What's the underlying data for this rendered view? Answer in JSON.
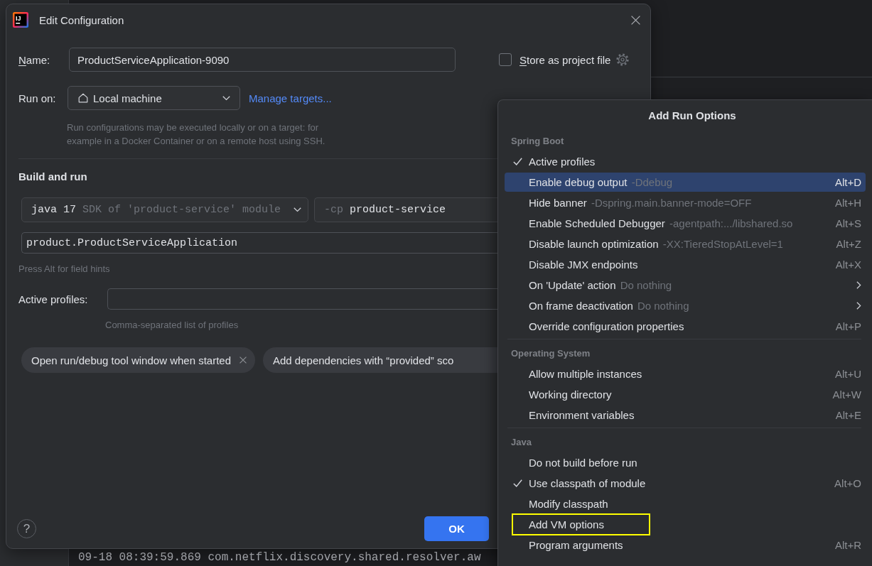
{
  "window": {
    "title": "Edit Configuration",
    "logo_text": "IJ"
  },
  "name": {
    "label": "Name:",
    "mnemonic": true,
    "value": "ProductServiceApplication-9090"
  },
  "store_as_project_file": {
    "label": "Store as project file",
    "mnemonic": true,
    "checked": false
  },
  "run_on": {
    "label": "Run on:",
    "value": "Local machine",
    "link": "Manage targets...",
    "hint_lines": [
      "Run configurations may be executed locally or on a target: for",
      "example in a Docker Container or on a remote host using SSH."
    ]
  },
  "build_and_run": {
    "heading": "Build and run",
    "jre": {
      "value": "java 17",
      "hint": "SDK of 'product-service' module"
    },
    "classpath": {
      "prefix": "-cp",
      "value": "product-service"
    },
    "main_class": {
      "value": "product.ProductServiceApplication"
    },
    "field_hint": "Press Alt for field hints"
  },
  "active_profiles": {
    "label": "Active profiles:",
    "hint": "Comma-separated list of profiles"
  },
  "option_chips": [
    {
      "label": "Open run/debug tool window when started",
      "removable": true
    },
    {
      "label": "Add dependencies with “provided” sco",
      "removable": false
    }
  ],
  "footer": {
    "help": "?",
    "ok": "OK"
  },
  "run_options": {
    "title": "Add Run Options",
    "sections": [
      {
        "title": "Spring Boot",
        "items": [
          {
            "kind": "option",
            "label": "Active profiles",
            "checked": true,
            "selected": false,
            "outlined": false
          },
          {
            "kind": "option",
            "label": "Enable debug output",
            "hint": "-Ddebug",
            "shortcut": "Alt+D",
            "checked": false,
            "selected": true,
            "outlined": false
          },
          {
            "kind": "option",
            "label": "Hide banner",
            "hint": "-Dspring.main.banner-mode=OFF",
            "shortcut": "Alt+H",
            "checked": false,
            "selected": false,
            "outlined": false
          },
          {
            "kind": "option",
            "label": "Enable Scheduled Debugger",
            "hint": "-agentpath:.../libshared.so",
            "shortcut": "Alt+S",
            "checked": false,
            "selected": false,
            "outlined": false
          },
          {
            "kind": "option",
            "label": "Disable launch optimization",
            "hint": "-XX:TieredStopAtLevel=1",
            "shortcut": "Alt+Z",
            "checked": false,
            "selected": false,
            "outlined": false
          },
          {
            "kind": "option",
            "label": "Disable JMX endpoints",
            "shortcut": "Alt+X",
            "checked": false,
            "selected": false,
            "outlined": false
          },
          {
            "kind": "submenu",
            "label": "On 'Update' action",
            "hint": "Do nothing",
            "checked": false,
            "selected": false,
            "outlined": false
          },
          {
            "kind": "submenu",
            "label": "On frame deactivation",
            "hint": "Do nothing",
            "checked": false,
            "selected": false,
            "outlined": false
          },
          {
            "kind": "option",
            "label": "Override configuration properties",
            "shortcut": "Alt+P",
            "checked": false,
            "selected": false,
            "outlined": false
          }
        ]
      },
      {
        "title": "Operating System",
        "items": [
          {
            "kind": "option",
            "label": "Allow multiple instances",
            "shortcut": "Alt+U",
            "checked": false,
            "selected": false,
            "outlined": false
          },
          {
            "kind": "option",
            "label": "Working directory",
            "shortcut": "Alt+W",
            "checked": false,
            "selected": false,
            "outlined": false
          },
          {
            "kind": "option",
            "label": "Environment variables",
            "shortcut": "Alt+E",
            "checked": false,
            "selected": false,
            "outlined": false
          }
        ]
      },
      {
        "title": "Java",
        "items": [
          {
            "kind": "option",
            "label": "Do not build before run",
            "checked": false,
            "selected": false,
            "outlined": false
          },
          {
            "kind": "option",
            "label": "Use classpath of module",
            "shortcut": "Alt+O",
            "checked": true,
            "selected": false,
            "outlined": false
          },
          {
            "kind": "option",
            "label": "Modify classpath",
            "checked": false,
            "selected": false,
            "outlined": false
          },
          {
            "kind": "option",
            "label": "Add VM options",
            "checked": false,
            "selected": false,
            "outlined": true
          },
          {
            "kind": "option",
            "label": "Program arguments",
            "shortcut": "Alt+R",
            "checked": false,
            "selected": false,
            "outlined": false
          }
        ]
      }
    ]
  },
  "console": {
    "lines": [
      "09-18 08:39:59.869 com.netflix.discovery.shared.resolver.aw"
    ]
  }
}
